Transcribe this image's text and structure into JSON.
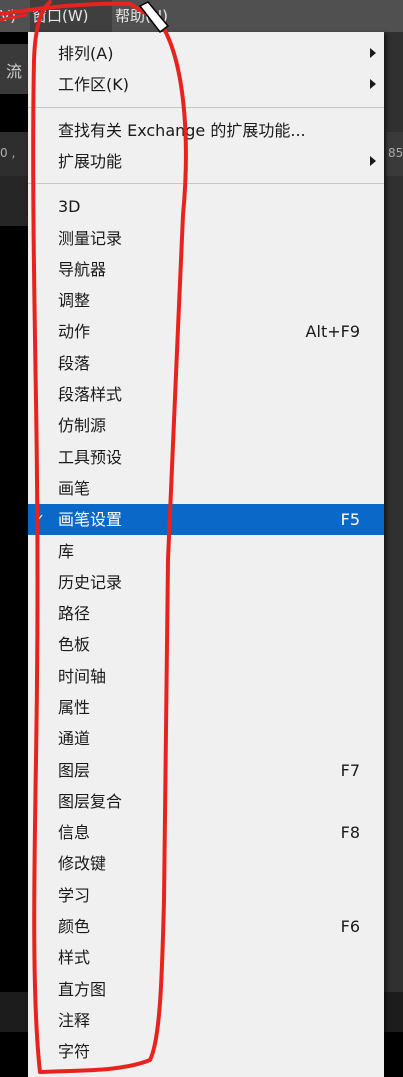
{
  "menubar": {
    "left_fragment": "V)",
    "window_label": "窗口(W)",
    "help_label": "帮助(H)"
  },
  "background": {
    "left_text": "流",
    "left_number": "0 ,",
    "right_number": "85"
  },
  "menu": {
    "groups": [
      [
        {
          "label": "排列(A)",
          "submenu": true
        },
        {
          "label": "工作区(K)",
          "submenu": true
        }
      ],
      [
        {
          "label": "查找有关 Exchange 的扩展功能...",
          "submenu": false
        },
        {
          "label": "扩展功能",
          "submenu": true
        }
      ],
      [
        {
          "label": "3D"
        },
        {
          "label": "测量记录"
        },
        {
          "label": "导航器"
        },
        {
          "label": "调整"
        },
        {
          "label": "动作",
          "shortcut": "Alt+F9"
        },
        {
          "label": "段落"
        },
        {
          "label": "段落样式"
        },
        {
          "label": "仿制源"
        },
        {
          "label": "工具预设"
        },
        {
          "label": "画笔"
        },
        {
          "label": "画笔设置",
          "shortcut": "F5",
          "checked": true,
          "selected": true
        },
        {
          "label": "库"
        },
        {
          "label": "历史记录"
        },
        {
          "label": "路径"
        },
        {
          "label": "色板"
        },
        {
          "label": "时间轴"
        },
        {
          "label": "属性"
        },
        {
          "label": "通道"
        },
        {
          "label": "图层",
          "shortcut": "F7"
        },
        {
          "label": "图层复合"
        },
        {
          "label": "信息",
          "shortcut": "F8"
        },
        {
          "label": "修改键"
        },
        {
          "label": "学习"
        },
        {
          "label": "颜色",
          "shortcut": "F6"
        },
        {
          "label": "样式"
        },
        {
          "label": "直方图"
        },
        {
          "label": "注释"
        },
        {
          "label": "字符"
        }
      ]
    ],
    "check_glyph": "✓"
  },
  "annotation": {
    "color": "#e8231f"
  },
  "colors": {
    "menu_bg": "#f0f0f0",
    "highlight": "#0a68c8",
    "menubar_bg": "#505050"
  }
}
